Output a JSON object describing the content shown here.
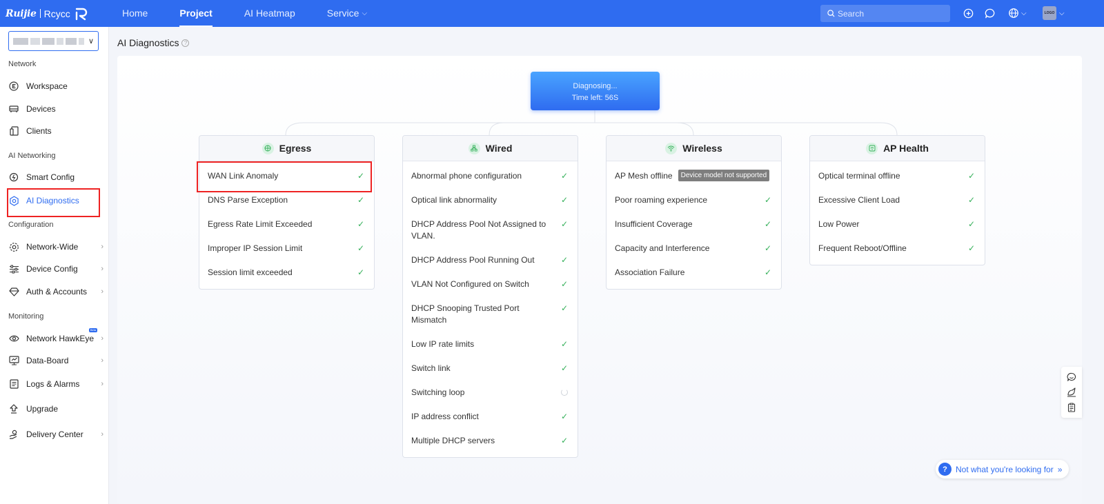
{
  "brand": {
    "name1": "Ruijie",
    "name2": "Rcycc"
  },
  "nav": {
    "items": [
      {
        "label": "Home"
      },
      {
        "label": "Project"
      },
      {
        "label": "AI Heatmap"
      },
      {
        "label": "Service"
      }
    ],
    "active": "Project"
  },
  "search": {
    "placeholder": "Search"
  },
  "avatar": {
    "text": "LOGO"
  },
  "sidebar": {
    "sections": {
      "network": "Network",
      "ai_networking": "AI Networking",
      "configuration": "Configuration",
      "monitoring": "Monitoring"
    },
    "items": {
      "workspace": "Workspace",
      "devices": "Devices",
      "clients": "Clients",
      "smart_config": "Smart Config",
      "ai_diagnostics": "AI Diagnostics",
      "network_wide": "Network-Wide",
      "device_config": "Device Config",
      "auth_accounts": "Auth & Accounts",
      "network_hawkeye": "Network HawkEye",
      "data_board": "Data-Board",
      "logs_alarms": "Logs & Alarms",
      "upgrade": "Upgrade",
      "delivery_center": "Delivery Center"
    },
    "active_item": "AI Diagnostics",
    "beta_badge": "Beta"
  },
  "page": {
    "title": "AI Diagnostics"
  },
  "diagnosis": {
    "status": "Diagnosing...",
    "time_left": "Time left: 56S"
  },
  "cards": {
    "egress": {
      "title": "Egress",
      "items": [
        {
          "label": "WAN Link Anomaly",
          "status": "ok"
        },
        {
          "label": "DNS Parse Exception",
          "status": "ok"
        },
        {
          "label": "Egress Rate Limit Exceeded",
          "status": "ok"
        },
        {
          "label": "Improper IP Session Limit",
          "status": "ok"
        },
        {
          "label": "Session limit exceeded",
          "status": "ok"
        }
      ]
    },
    "wired": {
      "title": "Wired",
      "items": [
        {
          "label": "Abnormal phone configuration",
          "status": "ok"
        },
        {
          "label": "Optical link abnormality",
          "status": "ok"
        },
        {
          "label": "DHCP Address Pool Not Assigned to VLAN.",
          "status": "ok"
        },
        {
          "label": "DHCP Address Pool Running Out",
          "status": "ok"
        },
        {
          "label": "VLAN Not Configured on Switch",
          "status": "ok"
        },
        {
          "label": "DHCP Snooping Trusted Port Mismatch",
          "status": "ok"
        },
        {
          "label": "Low IP rate limits",
          "status": "ok"
        },
        {
          "label": "Switch link",
          "status": "ok"
        },
        {
          "label": "Switching loop",
          "status": "loading"
        },
        {
          "label": "IP address conflict",
          "status": "ok"
        },
        {
          "label": "Multiple DHCP servers",
          "status": "ok"
        }
      ]
    },
    "wireless": {
      "title": "Wireless",
      "items": [
        {
          "label": "AP Mesh offline",
          "status": "unsupported",
          "tag": "Device model not supported"
        },
        {
          "label": "Poor roaming experience",
          "status": "ok"
        },
        {
          "label": "Insufficient Coverage",
          "status": "ok"
        },
        {
          "label": "Capacity and Interference",
          "status": "ok"
        },
        {
          "label": "Association Failure",
          "status": "ok"
        }
      ]
    },
    "ap_health": {
      "title": "AP Health",
      "items": [
        {
          "label": "Optical terminal offline",
          "status": "ok"
        },
        {
          "label": "Excessive Client Load",
          "status": "ok"
        },
        {
          "label": "Low Power",
          "status": "ok"
        },
        {
          "label": "Frequent Reboot/Offline",
          "status": "ok"
        }
      ]
    }
  },
  "help": {
    "label": "Not what you're looking for"
  },
  "colors": {
    "primary": "#2f6cf0",
    "ok": "#35b05a",
    "highlight": "#e22222"
  }
}
